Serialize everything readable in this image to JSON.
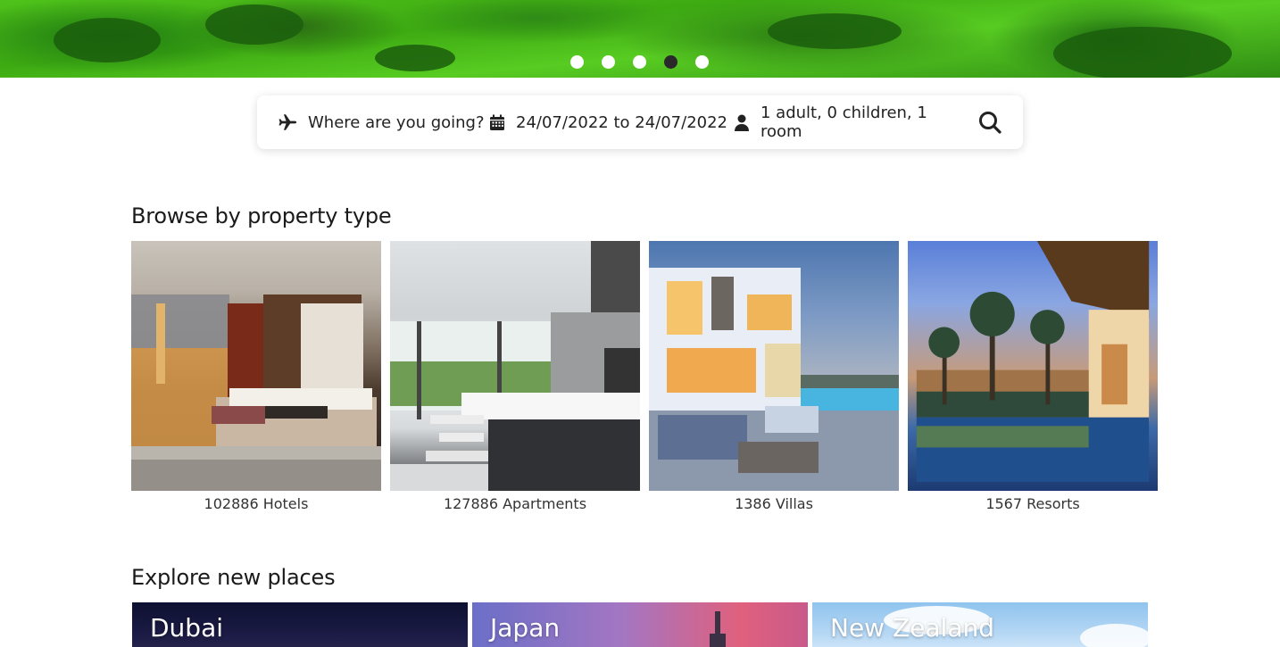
{
  "hero": {
    "slides": [
      {
        "active": false
      },
      {
        "active": false
      },
      {
        "active": false
      },
      {
        "active": true
      },
      {
        "active": false
      }
    ]
  },
  "search": {
    "destination_placeholder": "Where are you going?",
    "dates": "24/07/2022 to 24/07/2022",
    "guests": "1 adult, 0 children, 1 room"
  },
  "browse": {
    "title": "Browse by property type",
    "items": [
      {
        "label": "102886 Hotels"
      },
      {
        "label": "127886 Apartments"
      },
      {
        "label": "1386 Villas"
      },
      {
        "label": "1567 Resorts"
      }
    ]
  },
  "explore": {
    "title": "Explore new places",
    "places": [
      {
        "label": "Dubai"
      },
      {
        "label": "Japan"
      },
      {
        "label": "New Zealand"
      }
    ]
  },
  "colors": {
    "active_dot": "#2a2a2a",
    "inactive_dot": "#ffffff",
    "text": "#222222"
  }
}
